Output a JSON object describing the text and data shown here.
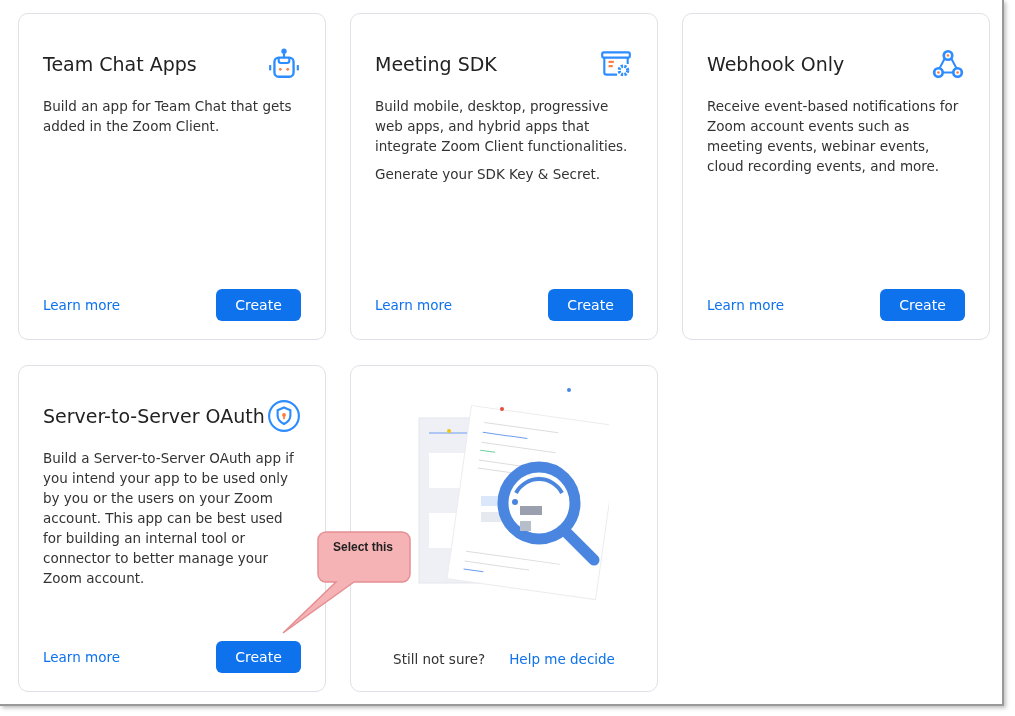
{
  "cards": [
    {
      "kind": "app",
      "title": "Team Chat Apps",
      "description": [
        "Build an app for Team Chat that gets added in the Zoom Client."
      ],
      "link": "Learn more",
      "button": "Create"
    },
    {
      "kind": "app",
      "title": "Meeting SDK",
      "description": [
        "Build mobile, desktop, progressive web apps, and hybrid apps that integrate Zoom Client functionalities.",
        "Generate your SDK Key & Secret."
      ],
      "link": "Learn more",
      "button": "Create"
    },
    {
      "kind": "app",
      "title": "Webhook Only",
      "description": [
        "Receive event-based notifications for Zoom account events such as meeting events, webinar events, cloud recording events, and more."
      ],
      "link": "Learn more",
      "button": "Create"
    },
    {
      "kind": "app",
      "title": "Server-to-Server OAuth",
      "description": [
        "Build a Server-to-Server OAuth app if you intend your app to be used only by you or the users on your Zoom account. This app can be best used for building an internal tool or connector to better manage your Zoom account."
      ],
      "link": "Learn more",
      "button": "Create"
    },
    {
      "kind": "help",
      "prompt": "Still not sure?",
      "link": "Help me decide"
    }
  ],
  "callout": {
    "text": "Select this"
  }
}
